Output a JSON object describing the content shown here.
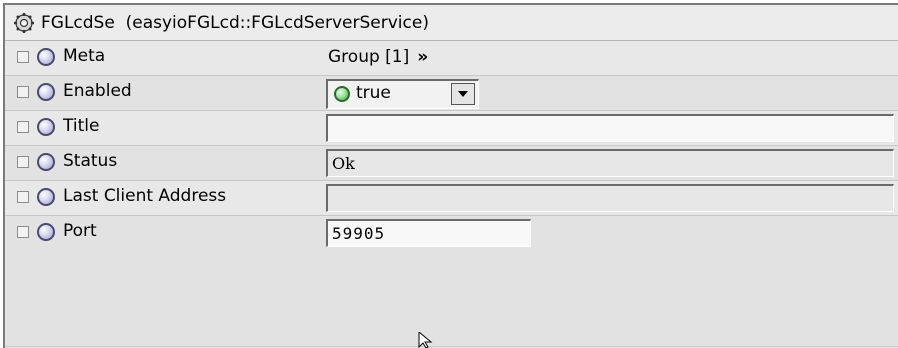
{
  "header": {
    "icon": "gear-icon",
    "title": "FGLcdSe  (easyioFGLcd::FGLcdServerService)"
  },
  "rows": [
    {
      "label": "Meta",
      "value": "Group [1]",
      "link_glyph": "»"
    },
    {
      "label": "Enabled",
      "value": "true",
      "status_color": "#55cc55"
    },
    {
      "label": "Title",
      "value": ""
    },
    {
      "label": "Status",
      "value": "Ok"
    },
    {
      "label": "Last Client Address",
      "value": ""
    },
    {
      "label": "Port",
      "value": "59905"
    }
  ]
}
